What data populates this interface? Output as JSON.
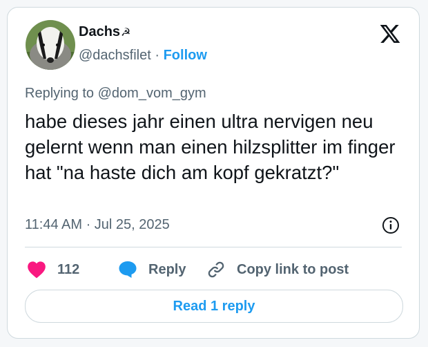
{
  "author": {
    "display_name": "Dachs",
    "name_emoji": "☭",
    "handle": "@dachsfilet",
    "separator": " · ",
    "follow_label": "Follow"
  },
  "reply_context": {
    "prefix": "Replying to ",
    "mention": "@dom_vom_gym"
  },
  "tweet": {
    "text": "habe dieses jahr einen ultra nervigen neu gelernt wenn man einen hilzsplitter im finger hat \"na haste dich am kopf gekratzt?\"",
    "timestamp": "11:44 AM · Jul 25, 2025"
  },
  "actions": {
    "like_count": "112",
    "reply_label": "Reply",
    "copy_link_label": "Copy link to post"
  },
  "read_replies_label": "Read 1 reply",
  "icons": {
    "brand": "x-logo-icon",
    "info": "info-icon",
    "like": "heart-icon",
    "reply": "reply-bubble-icon",
    "copy_link": "link-icon"
  },
  "colors": {
    "accent": "#1d9bf0",
    "like": "#f91880",
    "text": "#0f1419",
    "muted": "#536471",
    "border": "#cfd9de"
  }
}
